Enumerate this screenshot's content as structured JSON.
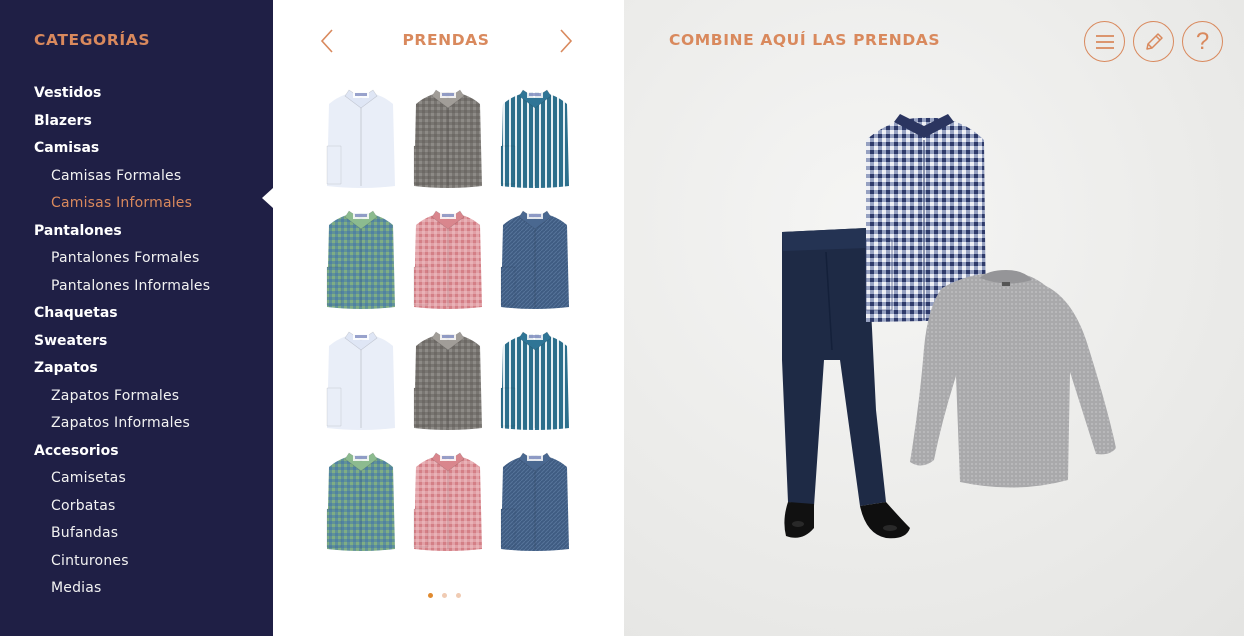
{
  "sidebar": {
    "title": "CATEGORÍAS",
    "items": [
      {
        "label": "Vestidos",
        "level": "main",
        "active": false
      },
      {
        "label": "Blazers",
        "level": "main",
        "active": false
      },
      {
        "label": "Camisas",
        "level": "main",
        "active": false
      },
      {
        "label": "Camisas Formales",
        "level": "sub",
        "active": false
      },
      {
        "label": "Camisas Informales",
        "level": "sub",
        "active": true
      },
      {
        "label": "Pantalones",
        "level": "main",
        "active": false
      },
      {
        "label": "Pantalones Formales",
        "level": "sub",
        "active": false
      },
      {
        "label": "Pantalones Informales",
        "level": "sub",
        "active": false
      },
      {
        "label": "Chaquetas",
        "level": "main",
        "active": false
      },
      {
        "label": "Sweaters",
        "level": "main",
        "active": false
      },
      {
        "label": "Zapatos",
        "level": "main",
        "active": false
      },
      {
        "label": "Zapatos Formales",
        "level": "sub",
        "active": false
      },
      {
        "label": "Zapatos Informales",
        "level": "sub",
        "active": false
      },
      {
        "label": "Accesorios",
        "level": "main",
        "active": false
      },
      {
        "label": "Camisetas",
        "level": "sub",
        "active": false
      },
      {
        "label": "Corbatas",
        "level": "sub",
        "active": false
      },
      {
        "label": "Bufandas",
        "level": "sub",
        "active": false
      },
      {
        "label": "Cinturones",
        "level": "sub",
        "active": false
      },
      {
        "label": "Medias",
        "level": "sub",
        "active": false
      }
    ]
  },
  "panel": {
    "title": "PRENDAS",
    "prev_icon": "chevron-left-icon",
    "next_icon": "chevron-right-icon",
    "shirts": [
      {
        "style": "plain",
        "color": "#e9eef8",
        "stripe": "#c7d0e6",
        "collar": "#dfe6f5"
      },
      {
        "style": "gingham",
        "color": "#8d8a86",
        "stripe": "#5f5b57",
        "collar": "#a19d98"
      },
      {
        "style": "stripe",
        "color": "#2c6f8c",
        "stripe": "#e6f0f4",
        "collar": "#2f7596"
      },
      {
        "style": "check",
        "color": "#7fae84",
        "stripe": "#3d6fb0",
        "collar": "#8cbb8f"
      },
      {
        "style": "check",
        "color": "#d47f86",
        "stripe": "#f2c9cc",
        "collar": "#d9868d"
      },
      {
        "style": "denim",
        "color": "#3f5c82",
        "stripe": "#56739a",
        "collar": "#4a6890"
      },
      {
        "style": "plain",
        "color": "#e9eef8",
        "stripe": "#c7d0e6",
        "collar": "#dfe6f5"
      },
      {
        "style": "gingham",
        "color": "#8d8a86",
        "stripe": "#5f5b57",
        "collar": "#a19d98"
      },
      {
        "style": "stripe",
        "color": "#2c6f8c",
        "stripe": "#e6f0f4",
        "collar": "#2f7596"
      },
      {
        "style": "check",
        "color": "#7fae84",
        "stripe": "#3d6fb0",
        "collar": "#8cbb8f"
      },
      {
        "style": "check",
        "color": "#d47f86",
        "stripe": "#f2c9cc",
        "collar": "#d9868d"
      },
      {
        "style": "denim",
        "color": "#3f5c82",
        "stripe": "#56739a",
        "collar": "#4a6890"
      }
    ],
    "pages": 3,
    "active_page": 0
  },
  "canvas": {
    "title": "COMBINE AQUÍ LAS PRENDAS",
    "buttons": [
      {
        "name": "menu-button",
        "icon": "hamburger-icon"
      },
      {
        "name": "edit-button",
        "icon": "pencil-icon"
      },
      {
        "name": "help-button",
        "icon": "question-icon",
        "label": "?"
      }
    ],
    "outfit_items": [
      "navy-trousers",
      "gingham-shirt",
      "grey-sweater",
      "black-shoes"
    ]
  },
  "colors": {
    "sidebar_bg": "#1f1f45",
    "accent": "#d9895d",
    "dot_active": "#e08a2f"
  }
}
